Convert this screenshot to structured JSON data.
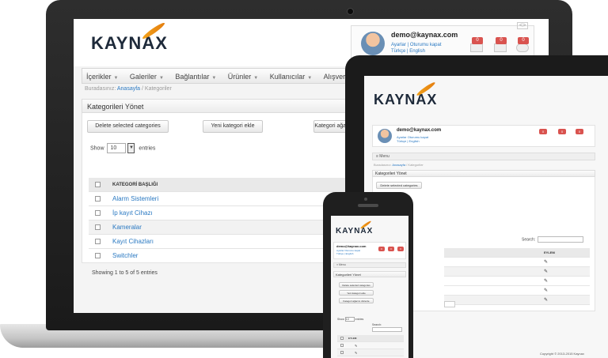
{
  "brand": {
    "logo": "KAYNAX",
    "accent": "#f3a51c"
  },
  "user": {
    "email": "demo@kaynax.com",
    "links": [
      "Ayarlar",
      "Oturumu kapat"
    ],
    "languages": [
      "Türkçe",
      "English"
    ],
    "badges": [
      "0",
      "0",
      "0"
    ],
    "mini_indicator": "<>"
  },
  "menu": [
    "İçerikler",
    "Galeriler",
    "Bağlantılar",
    "Ürünler",
    "Kullanıcılar",
    "Alışveriş"
  ],
  "breadcrumb": {
    "prefix": "Buradasınız:",
    "home": "Anasayfa",
    "separator": "/",
    "current": "Kategoriler"
  },
  "panel": {
    "title": "Kategorileri Yönet",
    "buttons": {
      "delete": "Delete selected categories",
      "new": "Yeni kategori ekle",
      "sort": "Kategori ağacı"
    },
    "phone_buttons": [
      "Delete selected categories",
      "Yeni kategori ekle",
      "Kategori ağacını düzenle"
    ]
  },
  "table": {
    "show_label": "Show",
    "show_value": "10",
    "entries_label": "entries",
    "search_label": "Search:",
    "col_title": "KATEGORİ BAŞLIĞI",
    "col_action": "EYLEM",
    "rows": [
      "Alarm Sistemleri",
      "İp kayıt Cihazı",
      "Kameralar",
      "Kayıt Cihazları",
      "Switchler"
    ],
    "summary": "Showing 1 to 5 of 5 entries"
  },
  "mobile_menu": "≡ Menu",
  "footer": {
    "copyright": "Copyright © 2013-2015 Kaynax"
  }
}
